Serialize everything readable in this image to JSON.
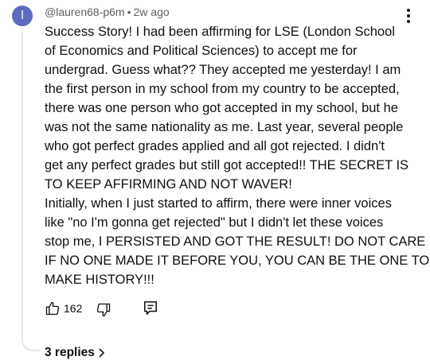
{
  "comment": {
    "avatar_letter": "l",
    "avatar_color": "#5c6bc0",
    "author": "@lauren68-p6m",
    "separator": "•",
    "time": "2w ago",
    "body_lines": [
      "Success Story! I had been affirming for LSE (London School",
      "of Economics and Political Sciences) to accept me for",
      "undergrad. Guess what?? They accepted me yesterday! I am",
      "the first person in my school from my country to be accepted,",
      "there was one person who got accepted in my school, but he",
      "was not the same nationality as me. Last year, several people",
      "who got perfect grades applied and all got rejected. I didn't",
      "get any perfect grades but still got accepted!! THE SECRET IS",
      "TO KEEP AFFIRMING AND NOT WAVER!",
      "Initially, when I just started to affirm, there were inner voices",
      "like \"no I'm gonna get rejected\" but I didn't let these voices",
      "stop me, I PERSISTED AND GOT THE RESULT! DO NOT CARE",
      "IF NO ONE MADE IT BEFORE YOU, YOU CAN BE THE ONE TO",
      "MAKE HISTORY!!!"
    ],
    "like_count": "162",
    "replies_label": "3 replies",
    "icons": {
      "like": "thumbs-up-icon",
      "dislike": "thumbs-down-icon",
      "reply": "reply-icon",
      "menu": "more-vert-icon",
      "replies_chevron": "chevron-right-icon"
    }
  }
}
